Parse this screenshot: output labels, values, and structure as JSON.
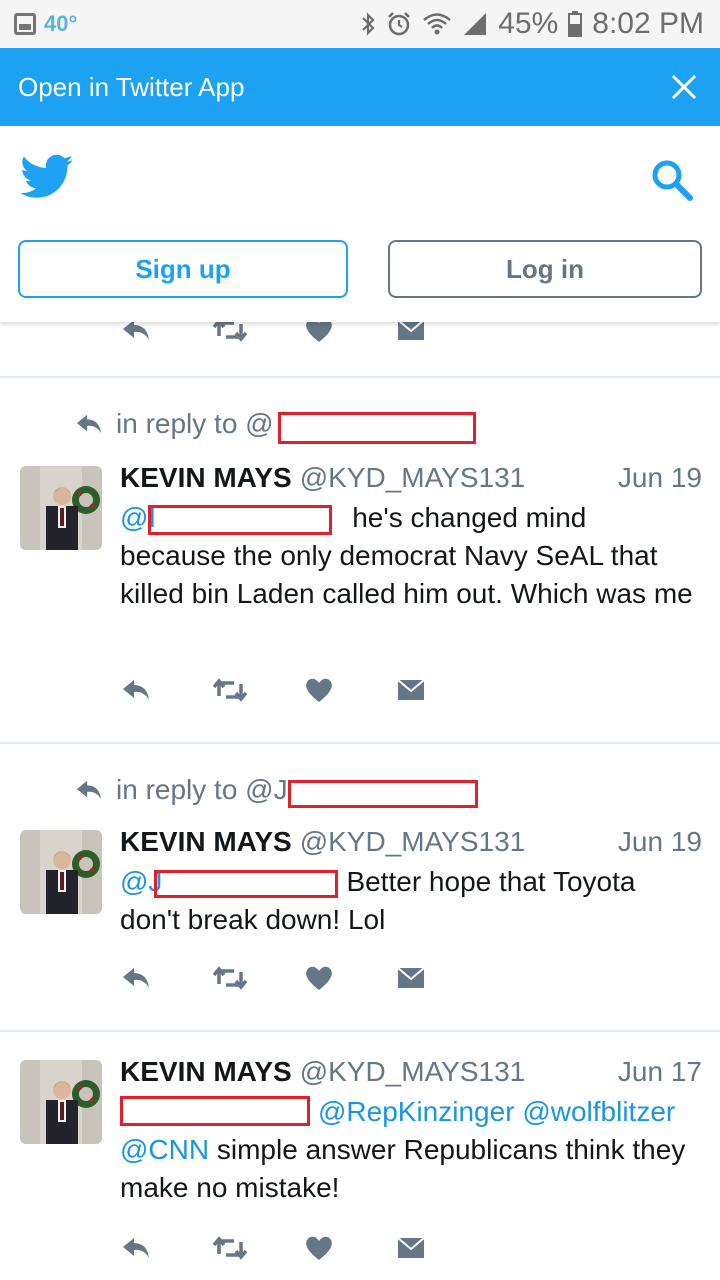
{
  "status_bar": {
    "temperature": "40°",
    "battery": "45%",
    "time": "8:02 PM",
    "icons": [
      "gallery-icon",
      "bluetooth-icon",
      "alarm-icon",
      "wifi-icon",
      "signal-icon",
      "battery-icon"
    ]
  },
  "banner": {
    "label": "Open in Twitter App",
    "close_icon": "close-icon"
  },
  "header": {
    "logo_icon": "twitter-bird-icon",
    "search_icon": "search-icon",
    "signup_label": "Sign up",
    "login_label": "Log in"
  },
  "colors": {
    "brand": "#1da1f2",
    "link": "#1b95e0",
    "muted": "#657786",
    "redaction": "#e0202a"
  },
  "tweets": [
    {
      "reply_to": "in reply to @",
      "name": "KEVIN MAYS",
      "handle": "@KYD_MAYS131",
      "date": "Jun 19",
      "mention_prefix": "@I",
      "line1": "he's changed mind",
      "body": "because the only democrat Navy SeAL that killed bin Laden called him out. Which was me"
    },
    {
      "reply_to": "in reply to @J",
      "name": "KEVIN MAYS",
      "handle": "@KYD_MAYS131",
      "date": "Jun 19",
      "mention_prefix": "@J",
      "line1": "Better hope that Toyota",
      "body": "don't break down! Lol"
    },
    {
      "name": "KEVIN MAYS",
      "handle": "@KYD_MAYS131",
      "date": "Jun 17",
      "mention1": "@RepKinzinger",
      "mention2": "@wolfblitzer",
      "mention3": "@CNN",
      "body": "simple answer Republicans think they make no mistake!"
    }
  ]
}
